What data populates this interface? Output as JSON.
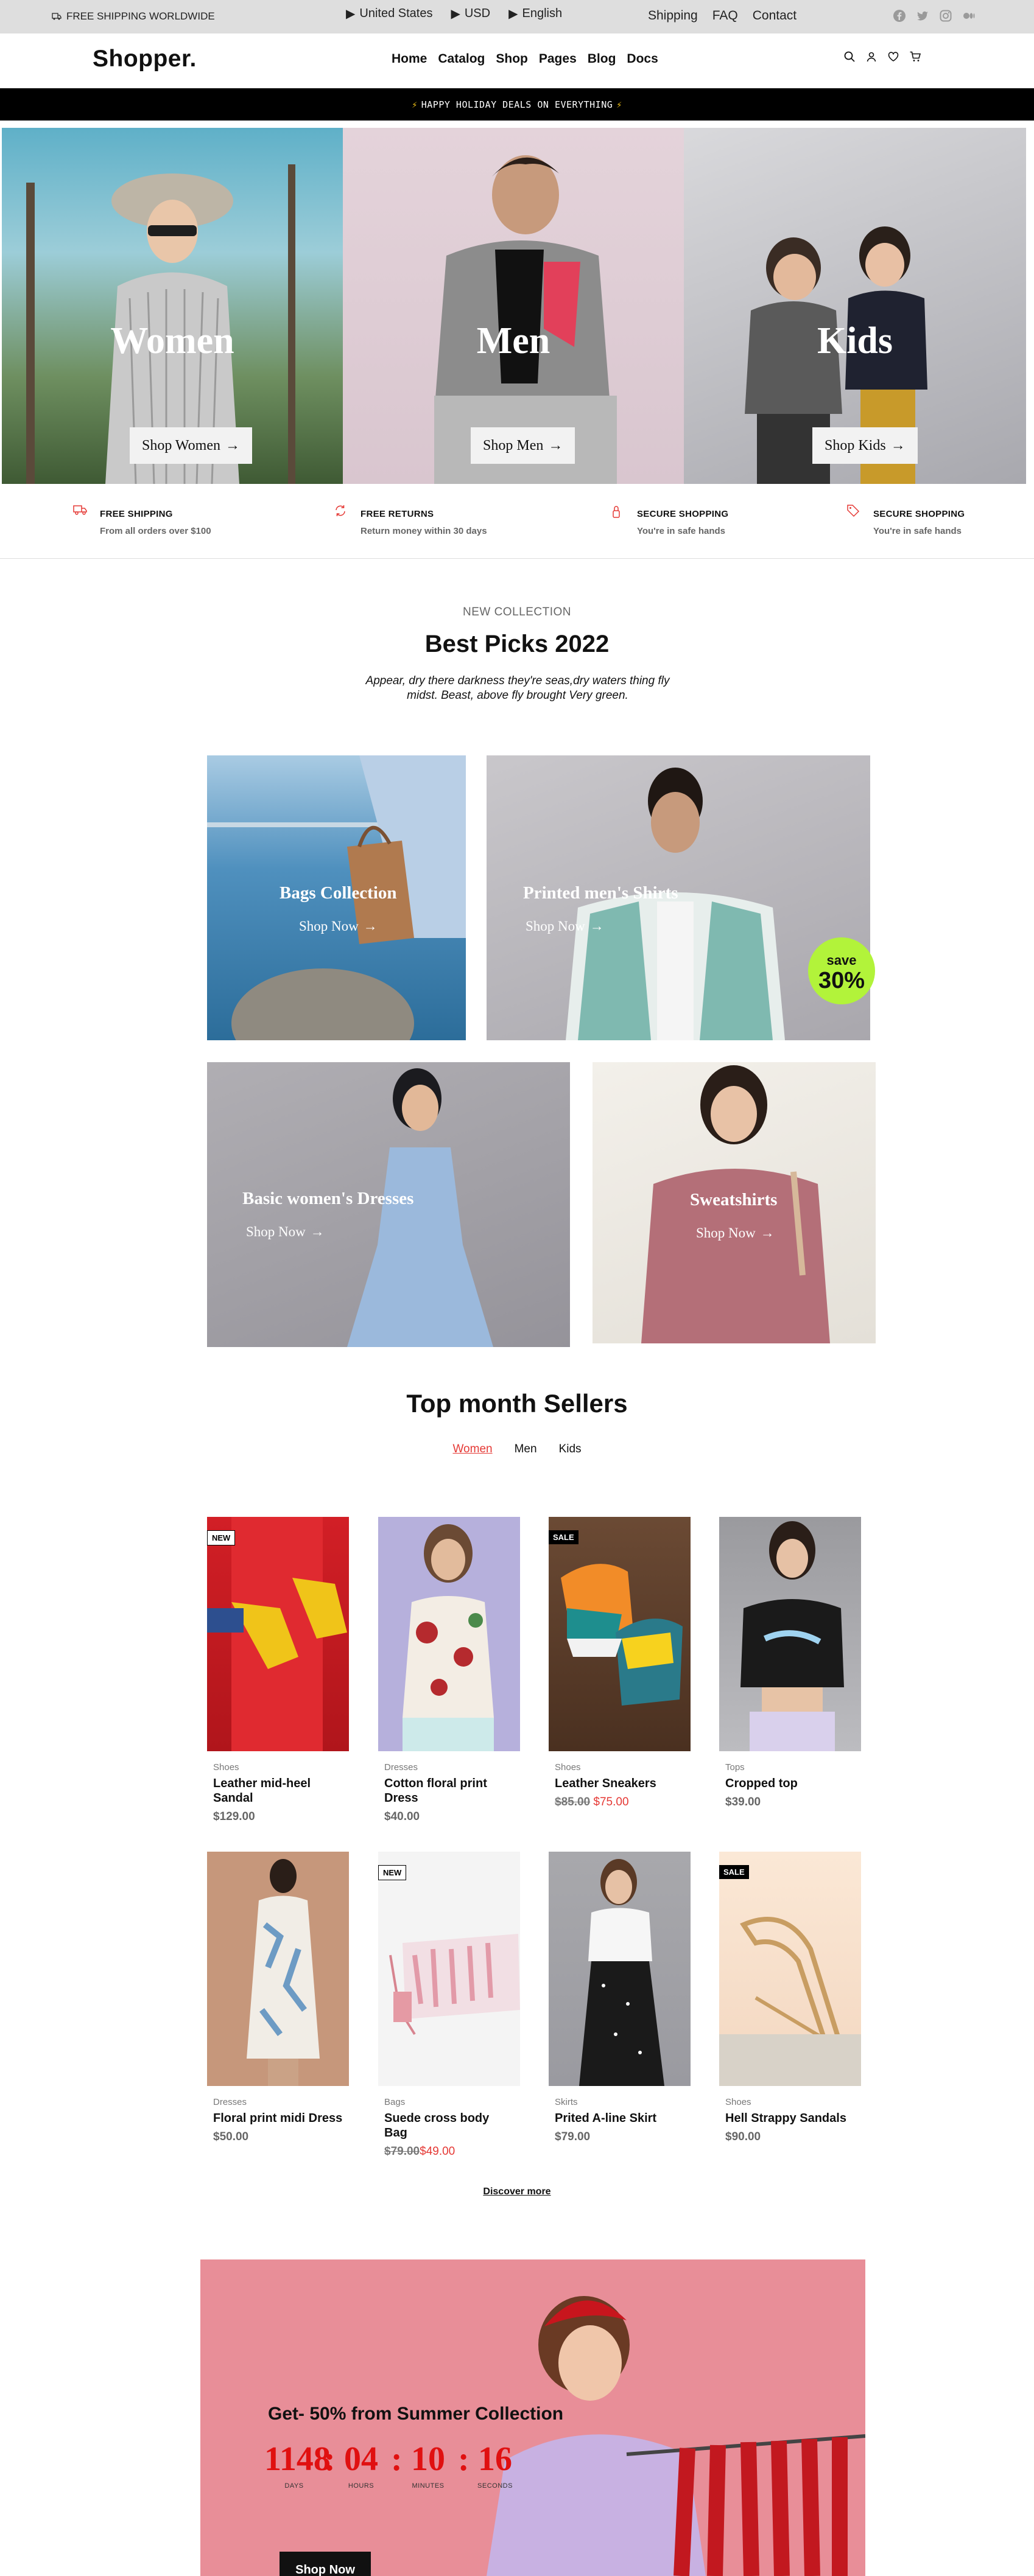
{
  "topbar": {
    "shipping": "FREE SHIPPING WORLDWIDE",
    "country": "United States",
    "currency": "USD",
    "language": "English",
    "links": [
      "Shipping",
      "FAQ",
      "Contact"
    ],
    "social_icons": [
      "facebook-icon",
      "twitter-icon",
      "instagram-icon",
      "medium-icon"
    ]
  },
  "header": {
    "logo": "Shopper.",
    "nav": [
      "Home",
      "Catalog",
      "Shop",
      "Pages",
      "Blog",
      "Docs"
    ],
    "icons": [
      "search-icon",
      "user-icon",
      "heart-icon",
      "cart-icon"
    ]
  },
  "promo": {
    "text": "HAPPY HOLIDAY DEALS ON EVERYTHING"
  },
  "hero": [
    {
      "title": "Women",
      "button": "Shop Women"
    },
    {
      "title": "Men",
      "button": "Shop Men"
    },
    {
      "title": "Kids",
      "button": "Shop Kids"
    }
  ],
  "features": [
    {
      "title": "FREE SHIPPING",
      "subtitle": "From all orders over $100",
      "icon": "truck-icon"
    },
    {
      "title": "FREE RETURNS",
      "subtitle": "Return money within 30 days",
      "icon": "refresh-icon"
    },
    {
      "title": "SECURE SHOPPING",
      "subtitle": "You're in safe hands",
      "icon": "lock-icon"
    },
    {
      "title": "SECURE SHOPPING",
      "subtitle": "You're in safe hands",
      "icon": "tag-icon"
    }
  ],
  "best_picks": {
    "label": "NEW COLLECTION",
    "title": "Best Picks 2022",
    "description": "Appear, dry there darkness they're seas,dry waters thing fly midst. Beast, above fly brought Very green.",
    "tiles": [
      {
        "title": "Bags Collection",
        "link": "Shop Now"
      },
      {
        "title": "Printed men's Shirts",
        "link": "Shop Now"
      },
      {
        "title": "Basic women's Dresses",
        "link": "Shop Now"
      },
      {
        "title": "Sweatshirts",
        "link": "Shop Now"
      }
    ],
    "badge": {
      "line1": "save",
      "line2": "30%"
    }
  },
  "top_sellers": {
    "title": "Top month Sellers",
    "tabs": [
      "Women",
      "Men",
      "Kids"
    ],
    "active_tab": "Women",
    "products": [
      {
        "badge": "NEW",
        "category": "Shoes",
        "name": "Leather mid-heel Sandal",
        "price": "$129.00",
        "old_price": ""
      },
      {
        "badge": "",
        "category": "Dresses",
        "name": "Cotton floral print Dress",
        "price": "$40.00",
        "old_price": ""
      },
      {
        "badge": "SALE",
        "category": "Shoes",
        "name": "Leather Sneakers",
        "price": "$75.00",
        "old_price": "$85.00"
      },
      {
        "badge": "",
        "category": "Tops",
        "name": "Cropped top",
        "price": "$39.00",
        "old_price": ""
      },
      {
        "badge": "",
        "category": "Dresses",
        "name": "Floral print midi Dress",
        "price": "$50.00",
        "old_price": ""
      },
      {
        "badge": "NEW",
        "category": "Bags",
        "name": "Suede cross body Bag",
        "price": "$49.00",
        "old_price": "$79.00"
      },
      {
        "badge": "",
        "category": "Skirts",
        "name": "Prited A-line Skirt",
        "price": "$79.00",
        "old_price": ""
      },
      {
        "badge": "SALE",
        "category": "Shoes",
        "name": "Hell Strappy Sandals",
        "price": "$90.00",
        "old_price": ""
      }
    ],
    "discover": "Discover more"
  },
  "sale_banner": {
    "title": "Get- 50% from Summer Collection",
    "countdown": [
      {
        "value": "1148",
        "label": "DAYS"
      },
      {
        "value": "04",
        "label": "HOURS"
      },
      {
        "value": "10",
        "label": "MINUTES"
      },
      {
        "value": "16",
        "label": "SECONDS"
      }
    ],
    "button": "Shop Now"
  },
  "colors": {
    "accent": "#e53935",
    "promo_bg": "#000000",
    "topbar_bg": "#dedede",
    "badge_green": "#b2f33a",
    "sale_bg": "#e88e98"
  }
}
